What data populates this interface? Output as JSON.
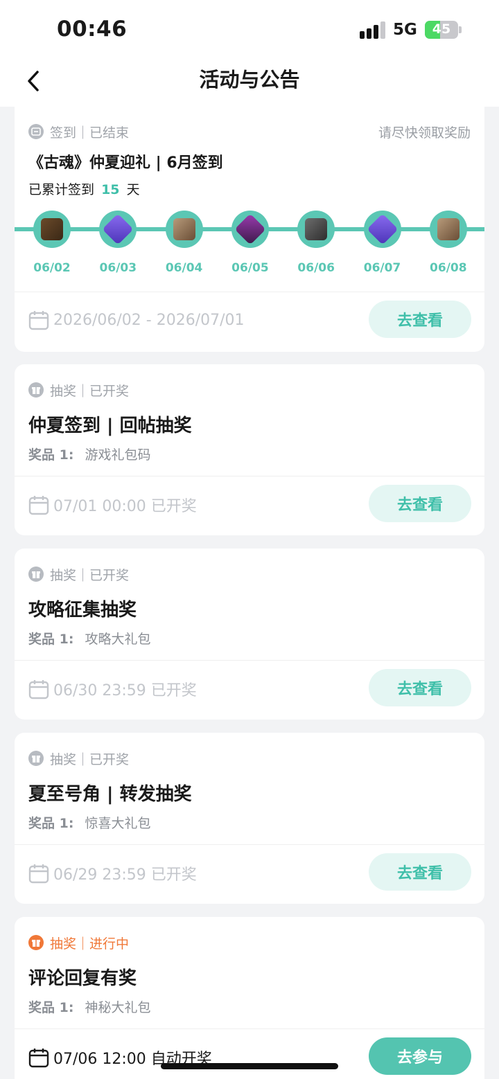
{
  "status_bar": {
    "time": "00:46",
    "network": "5G",
    "battery": "45"
  },
  "nav": {
    "title": "活动与公告"
  },
  "signin_card": {
    "type_label": "签到｜已结束",
    "hint": "请尽快领取奖励",
    "title": "《古魂》仲夏迎礼 | 6月签到",
    "summary_prefix": "已累计签到",
    "summary_count": "15",
    "summary_suffix": "天",
    "days": [
      {
        "label": "06/02",
        "icon": "treasure-chest-icon"
      },
      {
        "label": "06/03",
        "icon": "purple-crystal-icon"
      },
      {
        "label": "06/04",
        "icon": "ore-pouch-icon"
      },
      {
        "label": "06/05",
        "icon": "rune-gem-icon"
      },
      {
        "label": "06/06",
        "icon": "iron-chest-icon"
      },
      {
        "label": "06/07",
        "icon": "purple-crystal-icon"
      },
      {
        "label": "06/08",
        "icon": "ore-pouch-icon"
      }
    ],
    "date_range": "2026/06/02 - 2026/07/01",
    "button": "去查看"
  },
  "lottery_cards": [
    {
      "type_label": "抽奖｜已开奖",
      "title": "仲夏签到 | 回帖抽奖",
      "prize_label": "奖品 1:",
      "prize": "游戏礼包码",
      "date": "07/01 00:00 已开奖",
      "button": "去查看"
    },
    {
      "type_label": "抽奖｜已开奖",
      "title": "攻略征集抽奖",
      "prize_label": "奖品 1:",
      "prize": "攻略大礼包",
      "date": "06/30 23:59 已开奖",
      "button": "去查看"
    },
    {
      "type_label": "抽奖｜已开奖",
      "title": "夏至号角 | 转发抽奖",
      "prize_label": "奖品 1:",
      "prize": "惊喜大礼包",
      "date": "06/29 23:59 已开奖",
      "button": "去查看"
    },
    {
      "type_label": "抽奖｜进行中",
      "title": "评论回复有奖",
      "prize_label": "奖品 1:",
      "prize": "神秘大礼包",
      "date": "07/06 12:00 自动开奖",
      "button": "去参与"
    }
  ],
  "colors": {
    "accent": "#5bc7b4",
    "active": "#f07838",
    "muted": "#a0a4aa"
  }
}
